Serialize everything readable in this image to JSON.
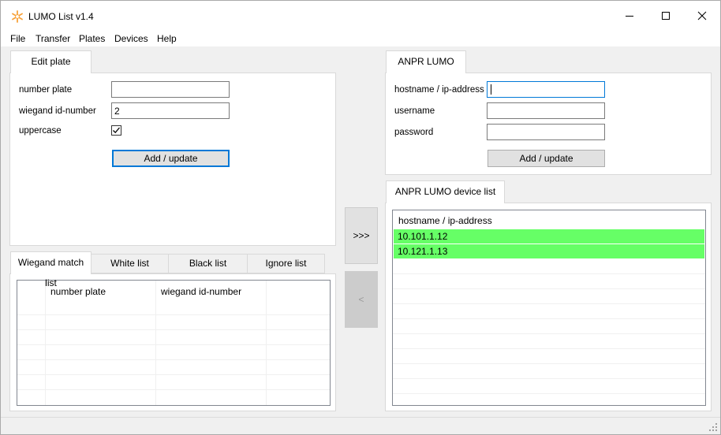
{
  "window": {
    "title": "LUMO List v1.4",
    "icon": "star-sparkle-icon",
    "controls": [
      "minimize-icon",
      "maximize-icon",
      "close-icon"
    ]
  },
  "menu": [
    "File",
    "Transfer",
    "Plates",
    "Devices",
    "Help"
  ],
  "edit_plate": {
    "tab": "Edit plate",
    "number_plate_label": "number plate",
    "number_plate_value": "",
    "wiegand_label": "wiegand id-number",
    "wiegand_value": "2",
    "uppercase_label": "uppercase",
    "uppercase_checked": true,
    "button": "Add / update"
  },
  "lists": {
    "tabs": [
      "Wiegand match list",
      "White list",
      "Black list",
      "Ignore list"
    ],
    "active_tab": 0,
    "columns": [
      "number plate",
      "wiegand id-number"
    ]
  },
  "transfer": {
    "send_button": ">>>",
    "back_button": "<"
  },
  "anpr": {
    "tab": "ANPR LUMO",
    "host_label": "hostname / ip-address",
    "host_value": "",
    "user_label": "username",
    "user_value": "",
    "pass_label": "password",
    "pass_value": "",
    "button": "Add / update"
  },
  "device_list": {
    "tab": "ANPR LUMO device list",
    "column": "hostname / ip-address",
    "rows": [
      "10.101.1.12",
      "10.121.1.13"
    ],
    "highlight_color": "#66ff66"
  }
}
